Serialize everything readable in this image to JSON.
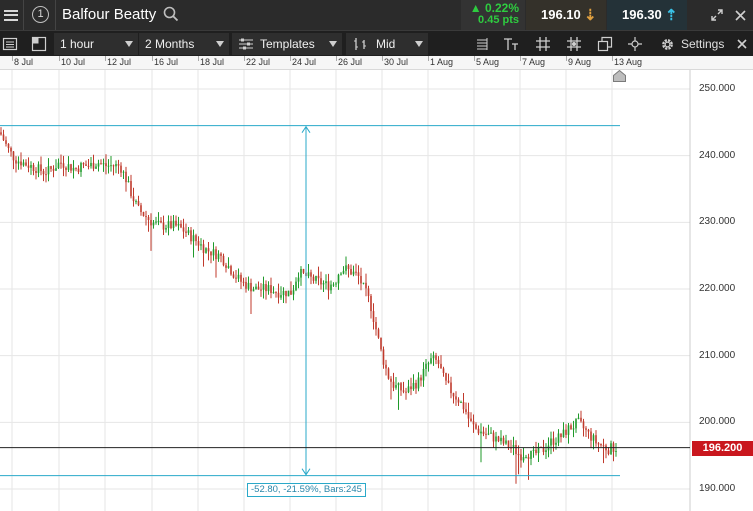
{
  "instrument": {
    "badge": "1",
    "name": "Balfour Beatty",
    "change_pct": "0.22%",
    "change_pts": "0.45 pts",
    "sell_price": "196.10",
    "buy_price": "196.30",
    "up_color": "#2ecc40",
    "sell_arrow_color": "#e0a040",
    "buy_arrow_color": "#39c1e6"
  },
  "toolbar": {
    "interval": "1 hour",
    "range": "2 Months",
    "templates": "Templates",
    "price_type": "Mid",
    "settings": "Settings"
  },
  "date_axis": [
    "8 Jul",
    "10 Jul",
    "12 Jul",
    "16 Jul",
    "18 Jul",
    "22 Jul",
    "24 Jul",
    "26 Jul",
    "30 Jul",
    "1 Aug",
    "5 Aug",
    "7 Aug",
    "9 Aug",
    "13 Aug"
  ],
  "price_axis": [
    "250.000",
    "240.000",
    "230.000",
    "220.000",
    "210.000",
    "200.000",
    "190.000"
  ],
  "current_price": "196.200",
  "measure": "-52.80, -21.59%, Bars:245",
  "chart_data": {
    "type": "candlestick",
    "ylim": [
      188,
      252
    ],
    "y_ticks": [
      190,
      200,
      210,
      220,
      230,
      240,
      250
    ],
    "grid": true,
    "current_price": 196.2,
    "measure_upper": 244.5,
    "measure_lower": 192,
    "colors": {
      "up": "#1f9a2a",
      "down": "#c0392b",
      "measure": "#2aa9c9",
      "grid": "#e6e6e6"
    },
    "path_x": [
      0,
      8,
      15,
      22,
      30,
      38,
      45,
      52,
      60,
      68,
      75,
      82,
      90,
      98,
      105,
      112,
      120,
      126,
      132,
      138,
      145,
      152,
      160,
      168,
      175,
      182,
      190,
      198,
      205,
      212,
      220,
      228,
      235,
      242,
      248,
      255,
      262,
      270,
      278,
      285,
      292,
      298,
      305,
      312,
      320,
      328,
      335,
      340,
      346,
      352,
      358,
      364,
      370,
      376,
      382,
      388,
      394,
      400,
      406,
      412,
      418,
      425,
      432,
      438,
      445,
      452,
      458,
      465,
      470,
      476,
      482,
      490,
      496,
      502,
      508,
      514,
      520,
      526,
      532,
      538,
      544,
      550,
      556,
      562,
      568,
      574,
      578,
      584,
      590,
      596,
      602,
      608,
      614,
      618
    ],
    "path_y": [
      243.5,
      241,
      239.5,
      239,
      238.5,
      238,
      237.5,
      238,
      239,
      238.5,
      238,
      238.5,
      238.5,
      239,
      238.5,
      238.5,
      238.5,
      236.5,
      234,
      232,
      231,
      230,
      229.5,
      229.5,
      229.5,
      229,
      228,
      227,
      226,
      225.5,
      225,
      223.5,
      222,
      221,
      220.5,
      220,
      220,
      220,
      219.5,
      219.5,
      219.5,
      222.5,
      222,
      221.5,
      221,
      220.5,
      221,
      223,
      223,
      222.5,
      222,
      220,
      218,
      214,
      210,
      207,
      205.5,
      205,
      204.5,
      205.5,
      206,
      208,
      209.5,
      209,
      206,
      204.5,
      203.5,
      202,
      200,
      199,
      198.5,
      198,
      197.5,
      197,
      196.5,
      196,
      195,
      195.5,
      195,
      195.5,
      196,
      197,
      197.5,
      198,
      199,
      199.5,
      200,
      199,
      198,
      197,
      196.5,
      196,
      196.2,
      196.2
    ]
  }
}
